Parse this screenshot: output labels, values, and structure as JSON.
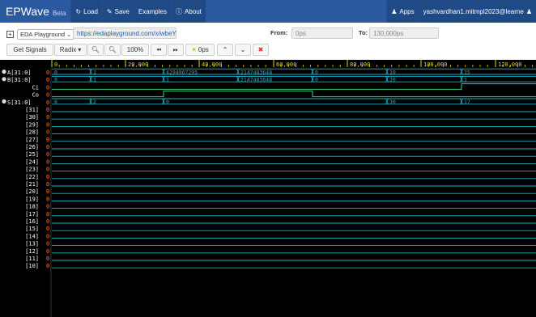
{
  "colors": {
    "navbar": "#2b5aa0",
    "wave_bg": "#000000",
    "trace": "#18b6c8",
    "highlight": "#2fd37a",
    "ruler": "#e8d800",
    "zero": "#ff7a1a",
    "name": "#ffffff"
  },
  "navbar": {
    "brand": "EPWave",
    "brand_suffix": "Beta",
    "load": "Load",
    "save": "Save",
    "examples": "Examples",
    "about": "About",
    "apps": "Apps",
    "user": "yashvardhan1.mitmpl2023@learne",
    "icons": {
      "load": "reload-icon",
      "save": "pencil-icon",
      "about": "info-icon",
      "apps": "person-icon",
      "user": "person-icon"
    }
  },
  "toolbar1": {
    "source_select": "EDA Playground",
    "url": "https://edaplayground.com/x/wbeY",
    "from_label": "From:",
    "from_value": "0ps",
    "to_label": "To:",
    "to_value": "130,000ps"
  },
  "toolbar2": {
    "get_signals": "Get Signals",
    "radix": "Radix",
    "zoom_level": "100%",
    "cursor_time": "0ps"
  },
  "ruler": {
    "ticks": [
      "0",
      "20,000",
      "40,000",
      "60,000",
      "80,000",
      "100,000",
      "120,000"
    ]
  },
  "signals": [
    {
      "name": "A[31:0]",
      "value": "0",
      "segments": [
        "0",
        "1",
        "4294967295",
        "2147483648",
        "0",
        "10",
        "15"
      ]
    },
    {
      "name": "B[31:0]",
      "value": "0",
      "segments": [
        "0",
        "1",
        "1",
        "2147483648",
        "0",
        "20",
        "1"
      ]
    },
    {
      "name": "Ci",
      "value": "0"
    },
    {
      "name": "Co",
      "value": "0"
    },
    {
      "name": "S[31:0]",
      "value": "0",
      "segments": [
        "0",
        "2",
        "0",
        "30",
        "17"
      ]
    },
    {
      "name": "[31]",
      "value": "0"
    },
    {
      "name": "[30]",
      "value": "0"
    },
    {
      "name": "[29]",
      "value": "0"
    },
    {
      "name": "[28]",
      "value": "0"
    },
    {
      "name": "[27]",
      "value": "0"
    },
    {
      "name": "[26]",
      "value": "0"
    },
    {
      "name": "[25]",
      "value": "0"
    },
    {
      "name": "[24]",
      "value": "0"
    },
    {
      "name": "[23]",
      "value": "0"
    },
    {
      "name": "[22]",
      "value": "0"
    },
    {
      "name": "[21]",
      "value": "0"
    },
    {
      "name": "[20]",
      "value": "0"
    },
    {
      "name": "[19]",
      "value": "0"
    },
    {
      "name": "[18]",
      "value": "0"
    },
    {
      "name": "[17]",
      "value": "0"
    },
    {
      "name": "[16]",
      "value": "0"
    },
    {
      "name": "[15]",
      "value": "0"
    },
    {
      "name": "[14]",
      "value": "0"
    },
    {
      "name": "[13]",
      "value": "0"
    },
    {
      "name": "[12]",
      "value": "0"
    },
    {
      "name": "[11]",
      "value": "0"
    },
    {
      "name": "[10]",
      "value": "0"
    }
  ]
}
